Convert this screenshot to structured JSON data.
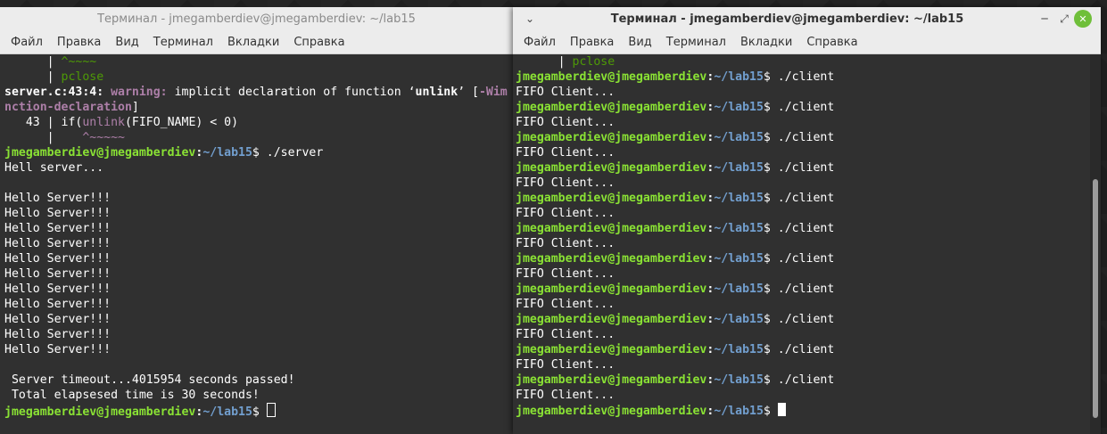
{
  "left_window": {
    "title": "Терминал - jmegamberdiev@jmegamberdiev: ~/lab15",
    "menu": [
      "Файл",
      "Правка",
      "Вид",
      "Терминал",
      "Вкладки",
      "Справка"
    ],
    "lines": [
      {
        "a": "      | ",
        "b": "^~~~~"
      },
      {
        "a": "      | ",
        "b": "pclose"
      },
      {
        "a": "server.c:43:4: ",
        "b": "warning: ",
        "c": "implicit declaration of function ‘",
        "d": "unlink",
        "e": "’ [",
        "f": "-Wim"
      },
      {
        "a": "nction-declaration",
        "b": "]"
      },
      {
        "a": "   43 | if(",
        "b": "unlink",
        "c": "(FIFO_NAME) < 0)"
      },
      {
        "a": "      |    ",
        "b": "^~~~~~"
      },
      {
        "user": "jmegamberdiev@jmegamberdiev",
        "path": "~/lab15",
        "cmd": "./server"
      },
      {
        "text": "Hell server..."
      },
      {
        "text": ""
      },
      {
        "text": "Hello Server!!!"
      },
      {
        "text": "Hello Server!!!"
      },
      {
        "text": "Hello Server!!!"
      },
      {
        "text": "Hello Server!!!"
      },
      {
        "text": "Hello Server!!!"
      },
      {
        "text": "Hello Server!!!"
      },
      {
        "text": "Hello Server!!!"
      },
      {
        "text": "Hello Server!!!"
      },
      {
        "text": "Hello Server!!!"
      },
      {
        "text": "Hello Server!!!"
      },
      {
        "text": "Hello Server!!!"
      },
      {
        "text": ""
      },
      {
        "text": " Server timeout...4015954 seconds passed!"
      },
      {
        "text": " Total elapsesed time is 30 seconds!"
      }
    ],
    "prompt": {
      "user": "jmegamberdiev@jmegamberdiev",
      "path": "~/lab15"
    }
  },
  "right_window": {
    "title": "Терминал - jmegamberdiev@jmegamberdiev: ~/lab15",
    "menu": [
      "Файл",
      "Правка",
      "Вид",
      "Терминал",
      "Вкладки",
      "Справка"
    ],
    "first_line": {
      "a": "      | ",
      "b": "pclose"
    },
    "user": "jmegamberdiev@jmegamberdiev",
    "path": "~/lab15",
    "cmd": "./client",
    "output": "FIFO Client...",
    "repeat_count_label": "11"
  },
  "icons": {
    "minimize": "minimize-icon",
    "restore": "restore-icon",
    "close": "close-icon",
    "menu": "window-menu-icon"
  }
}
